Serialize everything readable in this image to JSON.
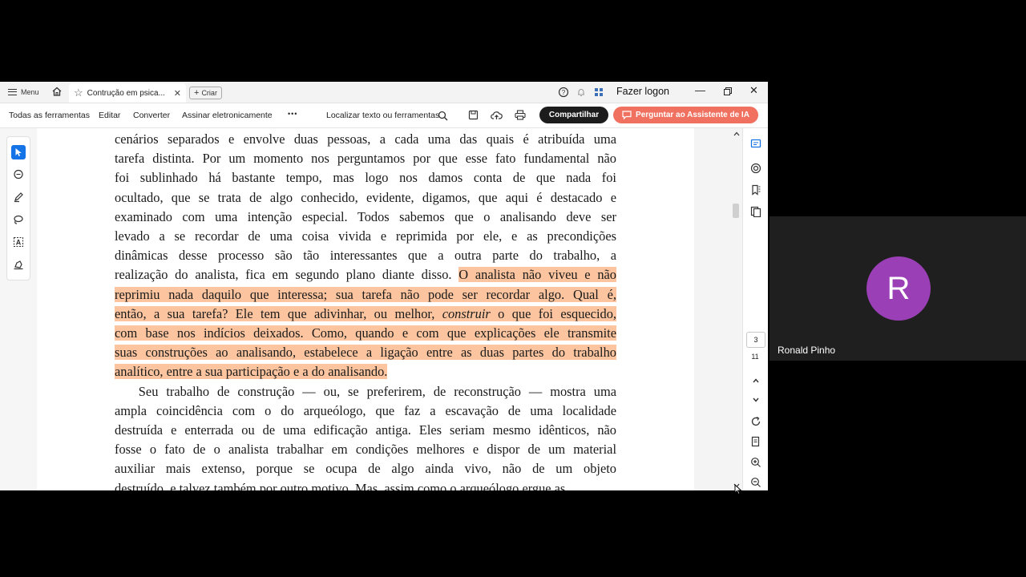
{
  "titlebar": {
    "menu_label": "Menu",
    "tab_title": "Contrução em psica...",
    "tab_close": "✕",
    "new_tab_label": "Criar",
    "login_label": "Fazer logon"
  },
  "toolbar": {
    "all_tools": "Todas as ferramentas",
    "edit": "Editar",
    "convert": "Converter",
    "sign": "Assinar eletronicamente",
    "more": "•••",
    "find": "Localizar texto ou ferramentas",
    "share": "Compartilhar",
    "ai_assistant": "Perguntar ao Assistente de IA"
  },
  "document": {
    "lines": [
      [
        {
          "t": "cenários separados e envolve duas pessoas, a cada uma das quais é atribuída uma"
        }
      ],
      [
        {
          "t": "tarefa distinta. Por um momento nos perguntamos por que esse fato fundamental não"
        }
      ],
      [
        {
          "t": "foi sublinhado há bastante tempo, mas logo nos damos conta de que nada foi"
        }
      ],
      [
        {
          "t": "ocultado, que se trata de algo conhecido, evidente, digamos, que aqui é destacado e"
        }
      ],
      [
        {
          "t": "examinado com uma intenção especial. Todos sabemos que o analisando deve ser"
        }
      ],
      [
        {
          "t": "levado a se recordar de uma coisa vivida e reprimida por ele, e as precondições"
        }
      ],
      [
        {
          "t": "dinâmicas desse processo são tão interessantes que a outra parte do trabalho, a"
        }
      ],
      [
        {
          "t": "realização do analista, fica em segundo plano diante disso. "
        },
        {
          "t": "O analista não viveu e não",
          "hl": true
        }
      ],
      [
        {
          "t": "reprimiu nada daquilo que interessa; sua tarefa não pode ser recordar algo. Qual é,",
          "hl": true
        }
      ],
      [
        {
          "t": "então, a sua tarefa? Ele tem que adivinhar, ou melhor, ",
          "hl": true
        },
        {
          "t": "construir",
          "hl": true,
          "i": true
        },
        {
          "t": " o que foi esquecido,",
          "hl": true
        }
      ],
      [
        {
          "t": "com base nos indícios deixados. Como, quando e com que explicações ele transmite",
          "hl": true
        }
      ],
      [
        {
          "t": "suas construções ao analisando, estabelece a ligação entre as duas partes do trabalho",
          "hl": true
        }
      ],
      [
        {
          "t": "analítico, entre a sua participação e a do analisando.",
          "hl": true
        }
      ],
      [
        {
          "t": "   Seu trabalho de construção — ou, se preferirem, de reconstrução — mostra uma"
        }
      ],
      [
        {
          "t": "ampla coincidência com o do arqueólogo, que faz a escavação de uma localidade"
        }
      ],
      [
        {
          "t": "destruída e enterrada ou de uma edificação antiga. Eles seriam mesmo idênticos, não"
        }
      ],
      [
        {
          "t": "fosse o fato de o analista trabalhar em condições melhores e dispor de um material"
        }
      ],
      [
        {
          "t": "auxiliar mais extenso, porque se ocupa de algo ainda vivo, não de um objeto"
        }
      ],
      [
        {
          "t": "destruído, e talvez também por outro motivo. Mas, assim como o arqueólogo ergue as"
        }
      ]
    ]
  },
  "page_nav": {
    "current_page": "3",
    "total_pages": "11"
  },
  "video": {
    "avatar_initial": "R",
    "participant_name": "Ronald Pinho",
    "avatar_color": "#9b3fb6"
  },
  "colors": {
    "highlight": "#fcc59f",
    "share_button": "#1c1c1c",
    "ai_button": "#f0715f",
    "selected_tool": "#1473e6"
  }
}
